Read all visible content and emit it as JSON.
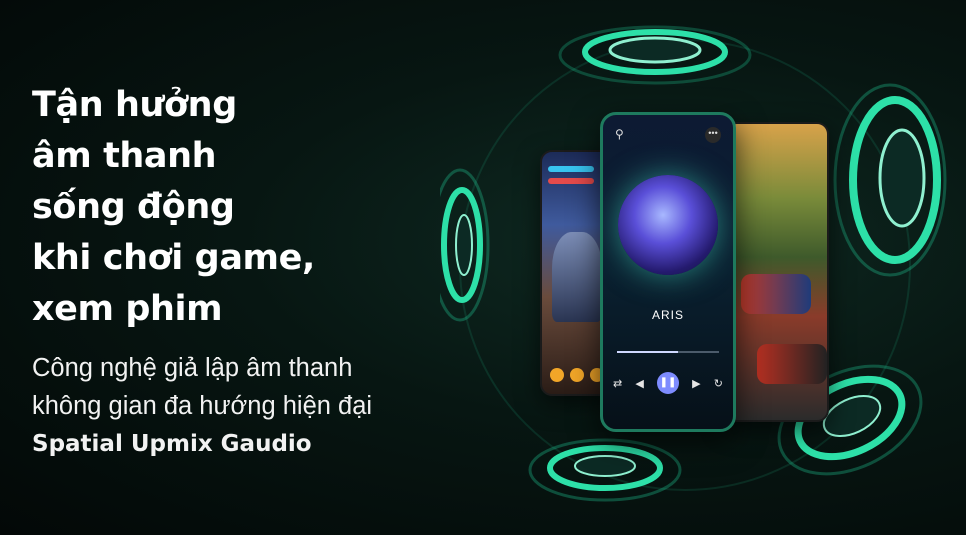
{
  "headline": [
    "Tận hưởng",
    "âm thanh",
    "sống động",
    "khi chơi game,",
    "xem phim"
  ],
  "subtext": {
    "line1": "Công nghệ giả lập âm thanh",
    "line2": "không gian đa hướng hiện đại",
    "brand": "Spatial Upmix Gaudio"
  },
  "player": {
    "track_title": "ARIS",
    "progress": 0.6,
    "icons": [
      "search-icon",
      "more-icon",
      "shuffle-icon",
      "previous-icon",
      "pause-icon",
      "next-icon",
      "repeat-icon"
    ]
  },
  "colors": {
    "accent": "#2de0a8",
    "ring": "#1fbf8f",
    "background": "#071612"
  }
}
